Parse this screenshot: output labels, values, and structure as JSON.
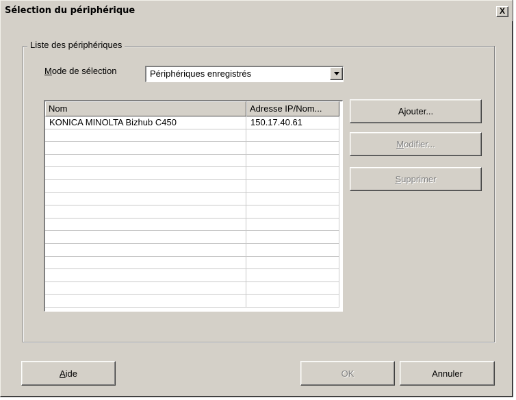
{
  "window": {
    "title": "Sélection du périphérique",
    "close_glyph": "X"
  },
  "group": {
    "label": "Liste des périphériques"
  },
  "mode": {
    "label_mnemonic": "M",
    "label_rest": "ode de sélection",
    "selected": "Périphériques enregistrés"
  },
  "list": {
    "columns": [
      "Nom",
      "Adresse IP/Nom..."
    ],
    "rows": [
      [
        "KONICA MINOLTA Bizhub C450",
        "150.17.40.61"
      ]
    ]
  },
  "buttons": {
    "add": "Ajouter...",
    "modify_mnemonic": "M",
    "modify_rest": "odifier...",
    "delete_mnemonic": "S",
    "delete_rest": "upprimer",
    "help_mnemonic": "A",
    "help_rest": "ide",
    "ok": "OK",
    "cancel": "Annuler"
  }
}
